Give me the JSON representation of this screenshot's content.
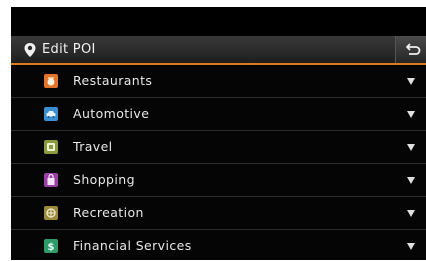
{
  "header": {
    "title": "Edit POI",
    "pin_icon": "map-pin-icon",
    "back_icon": "back-arrow-icon"
  },
  "categories": [
    {
      "label": "Restaurants",
      "icon": "restaurant-icon",
      "color": "#e2732a"
    },
    {
      "label": "Automotive",
      "icon": "car-icon",
      "color": "#3a8fd0"
    },
    {
      "label": "Travel",
      "icon": "travel-icon",
      "color": "#8a9a3c"
    },
    {
      "label": "Shopping",
      "icon": "shopping-icon",
      "color": "#9a3fa6"
    },
    {
      "label": "Recreation",
      "icon": "recreation-icon",
      "color": "#9a8a3a"
    },
    {
      "label": "Financial Services",
      "icon": "dollar-icon",
      "color": "#2e9a6a"
    }
  ],
  "colors": {
    "accent": "#e07a1f",
    "background": "#000000",
    "text": "#e8e8e8"
  }
}
